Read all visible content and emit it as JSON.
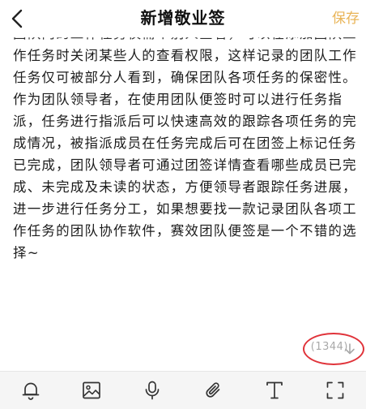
{
  "header": {
    "back_icon": "chevron-left-icon",
    "title": "新增敬业签",
    "save_label": "保存"
  },
  "editor": {
    "paragraphs": [
      "团队内的工作任务仅需个别人查看，可以在添加团队工作任务时关闭某些人的查看权限，这样记录的团队工作任务仅可被部分人看到，确保团队各项任务的保密性。",
      "作为团队领导者，在使用团队便签时可以进行任务指派，任务进行指派后可以快速高效的跟踪各项任务的完成情况，被指派成员在任务完成后可在团签上标记任务已完成，团队领导者可通过团签详情查看哪些成员已完成、未完成及未读的状态，方便领导者跟踪任务进展，进一步进行任务分工，如果想要找一款记录团队各项工作任务的团队协作软件，赛效团队便签是一个不错的选择~"
    ],
    "char_count": "(1344)"
  },
  "toolbar": {
    "items": [
      {
        "icon": "bell-icon"
      },
      {
        "icon": "image-icon"
      },
      {
        "icon": "microphone-icon"
      },
      {
        "icon": "paperclip-icon"
      },
      {
        "icon": "text-format-icon"
      },
      {
        "icon": "fullscreen-icon"
      }
    ]
  },
  "colors": {
    "accent": "#e9b457",
    "annotation_circle": "#e0333a",
    "counter_text": "#a9a9a9"
  }
}
